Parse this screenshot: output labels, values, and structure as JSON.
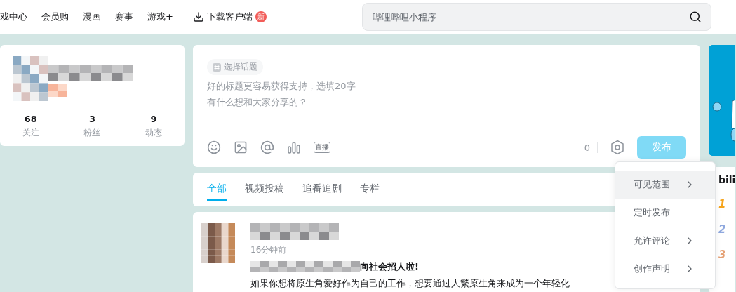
{
  "nav": {
    "items": [
      "戏中心",
      "会员购",
      "漫画",
      "赛事",
      "游戏+"
    ],
    "download": {
      "label": "下载客户端",
      "badge": "新"
    },
    "search": {
      "placeholder": "哔哩哔哩小程序"
    }
  },
  "profile": {
    "stats": [
      {
        "value": "68",
        "label": "关注"
      },
      {
        "value": "3",
        "label": "粉丝"
      },
      {
        "value": "9",
        "label": "动态"
      }
    ]
  },
  "composer": {
    "topic": "选择话题",
    "title_placeholder": "好的标题更容易获得支持，选填20字",
    "body_placeholder": "有什么想和大家分享的？",
    "live_label": "直播",
    "char_count": "0",
    "publish": {
      "label": "发布",
      "disabled": true
    }
  },
  "feed_tabs": [
    {
      "label": "全部",
      "selected": true
    },
    {
      "label": "视频投稿",
      "selected": false
    },
    {
      "label": "追番追剧",
      "selected": false
    },
    {
      "label": "专栏",
      "selected": false
    }
  ],
  "post": {
    "time": "16分钟前",
    "title": "向社会招人啦!",
    "body": "如果你想将原生角爱好作为自己的工作，想要通过人繁原生角来成为一个年轻化"
  },
  "menu": [
    {
      "label": "可见范围",
      "submenu": true,
      "selected": true
    },
    {
      "label": "定时发布",
      "submenu": false,
      "selected": false
    },
    {
      "label": "允许评论",
      "submenu": true,
      "selected": false
    },
    {
      "label": "创作声明",
      "submenu": true,
      "selected": false
    }
  ],
  "ranking": {
    "title": "bili",
    "ranks": [
      {
        "label": "1",
        "color": "#f6a51e"
      },
      {
        "label": "2",
        "color": "#8fa8de"
      },
      {
        "label": "3",
        "color": "#e5a175"
      }
    ]
  }
}
